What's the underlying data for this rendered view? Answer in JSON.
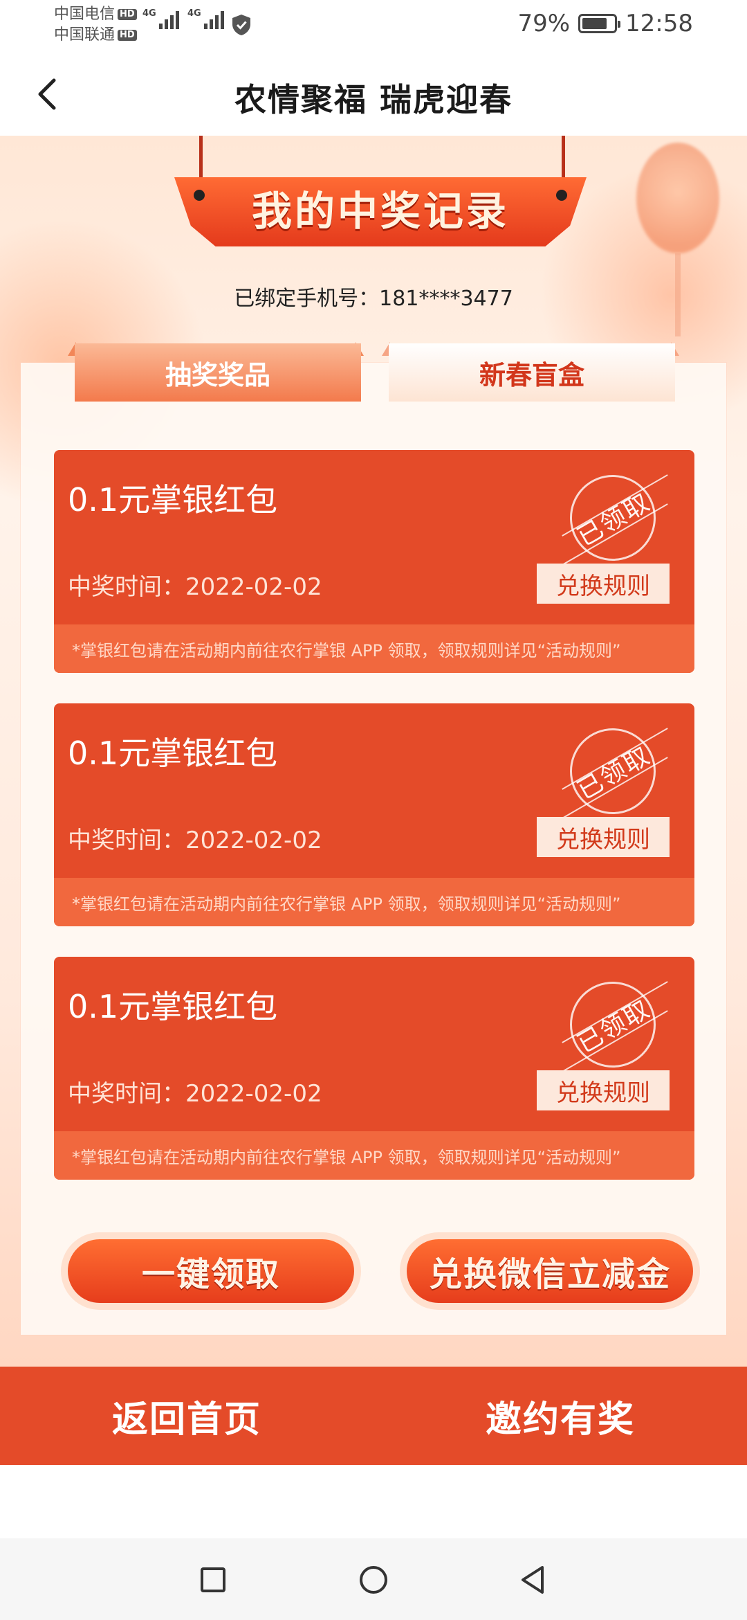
{
  "status_bar": {
    "carrier_1": "中国电信",
    "carrier_2": "中国联通",
    "hd_label": "HD",
    "network_label": "4G",
    "battery_percent": "79%",
    "battery_level": 0.79,
    "time": "12:58"
  },
  "header": {
    "title": "农情聚福 瑞虎迎春"
  },
  "banner": {
    "title": "我的中奖记录"
  },
  "phone": {
    "text": "已绑定手机号：181****3477"
  },
  "tabs": [
    {
      "label": "抽奖奖品",
      "active": true
    },
    {
      "label": "新春盲盒",
      "active": false
    }
  ],
  "prizes": [
    {
      "name": "0.1元掌银红包",
      "date": "中奖时间：2022-02-02",
      "stamp": "已领取",
      "rule_button": "兑换规则",
      "note": "*掌银红包请在活动期内前往农行掌银 APP 领取，领取规则详见“活动规则”"
    },
    {
      "name": "0.1元掌银红包",
      "date": "中奖时间：2022-02-02",
      "stamp": "已领取",
      "rule_button": "兑换规则",
      "note": "*掌银红包请在活动期内前往农行掌银 APP 领取，领取规则详见“活动规则”"
    },
    {
      "name": "0.1元掌银红包",
      "date": "中奖时间：2022-02-02",
      "stamp": "已领取",
      "rule_button": "兑换规则",
      "note": "*掌银红包请在活动期内前往农行掌银 APP 领取，领取规则详见“活动规则”"
    }
  ],
  "actions": {
    "claim_all": "一键领取",
    "exchange_wechat": "兑换微信立减金"
  },
  "bottom_nav": {
    "home": "返回首页",
    "invite": "邀约有奖"
  },
  "colors": {
    "primary_red": "#e44b29",
    "note_orange": "#f1683e",
    "tab_active": "#f37a4c",
    "tab_inactive_text": "#d2361b"
  },
  "icons": {
    "back": "chevron-left-icon",
    "security": "shield-check-icon",
    "nav_recent": "square-icon",
    "nav_home": "circle-icon",
    "nav_back": "triangle-back-icon"
  }
}
